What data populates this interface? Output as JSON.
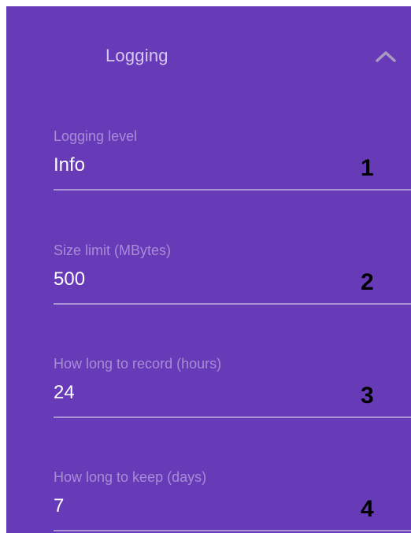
{
  "section": {
    "title": "Logging",
    "toggle_icon": "chevron-up-icon"
  },
  "fields": [
    {
      "label": "Logging level",
      "value": "Info",
      "callout": "1"
    },
    {
      "label": "Size limit (MBytes)",
      "value": "500",
      "callout": "2"
    },
    {
      "label": "How long to record (hours)",
      "value": "24",
      "callout": "3"
    },
    {
      "label": "How long to keep (days)",
      "value": "7",
      "callout": "4"
    }
  ],
  "colors": {
    "panel_background": "#673ab7",
    "title_text": "#d6c8f0",
    "value_text": "#ffffff",
    "callout_text": "#000000"
  }
}
